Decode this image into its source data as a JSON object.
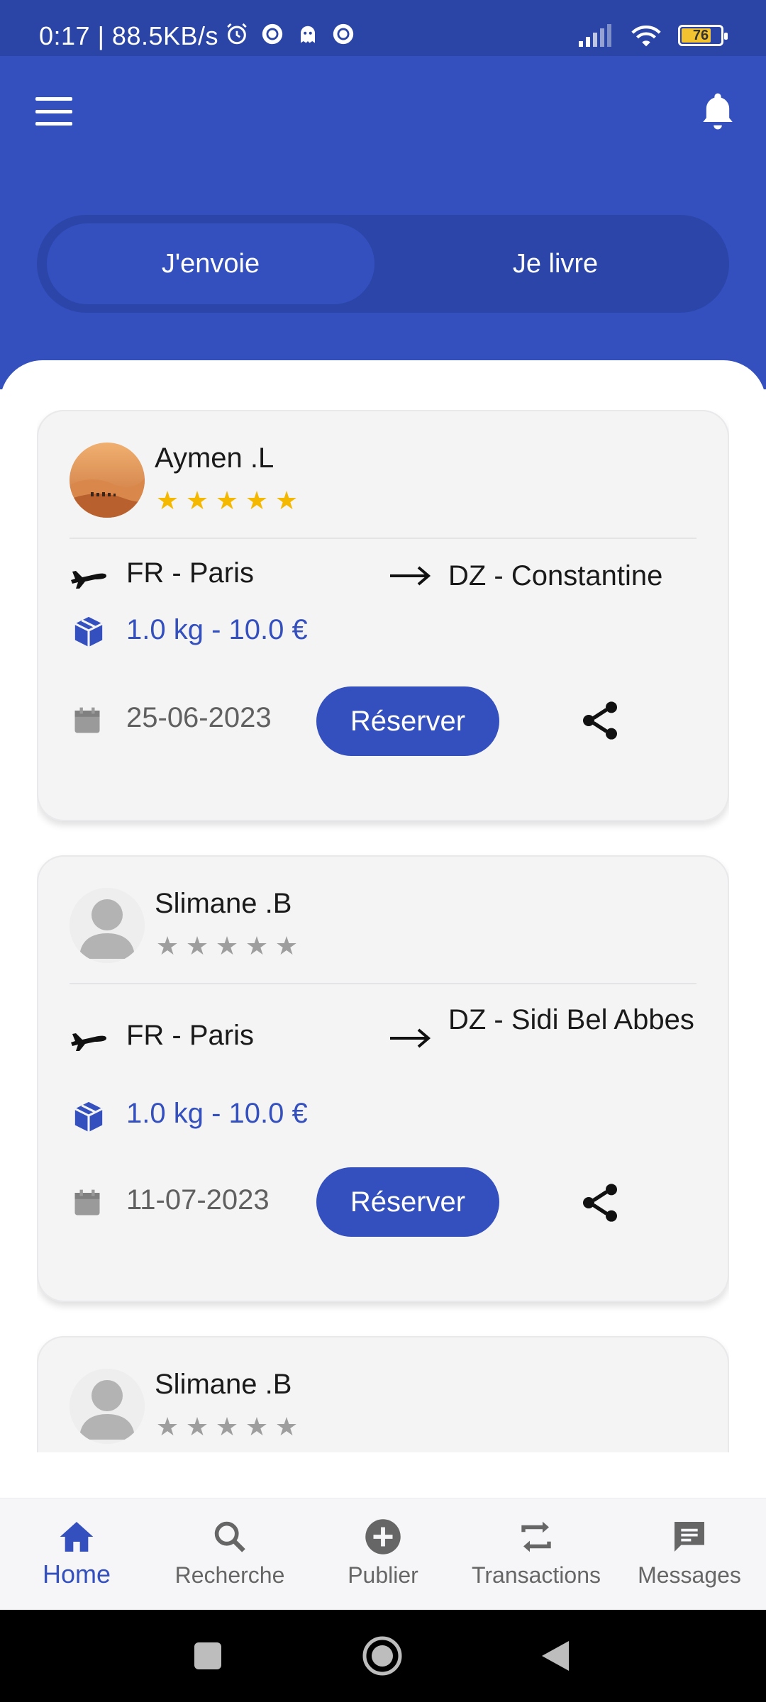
{
  "status_bar": {
    "time": "0:17 | 88.5KB/s",
    "battery": "76"
  },
  "header": {
    "tabs": [
      {
        "label": "J'envoie",
        "active": true
      },
      {
        "label": "Je livre",
        "active": false
      }
    ]
  },
  "cards": [
    {
      "name": "Aymen .L",
      "rating": 5,
      "from": "FR - Paris",
      "to": "DZ - Constantine",
      "package": "1.0 kg - 10.0 €",
      "date": "25-06-2023",
      "reserve_label": "Réserver"
    },
    {
      "name": "Slimane .B",
      "rating": 0,
      "from": "FR - Paris",
      "to": "DZ - Sidi Bel Abbes",
      "package": "1.0 kg - 10.0 €",
      "date": "11-07-2023",
      "reserve_label": "Réserver"
    },
    {
      "name": "Slimane .B",
      "rating": 0
    }
  ],
  "bottom_nav": [
    {
      "label": "Home",
      "icon": "home-icon",
      "active": true
    },
    {
      "label": "Recherche",
      "icon": "search-icon",
      "active": false
    },
    {
      "label": "Publier",
      "icon": "add-circle-icon",
      "active": false
    },
    {
      "label": "Transactions",
      "icon": "swap-icon",
      "active": false
    },
    {
      "label": "Messages",
      "icon": "message-icon",
      "active": false
    }
  ],
  "colors": {
    "primary": "#3450be",
    "status_bar": "#2b45a6",
    "star_active": "#f5b800",
    "star_inactive": "#9e9e9e"
  }
}
